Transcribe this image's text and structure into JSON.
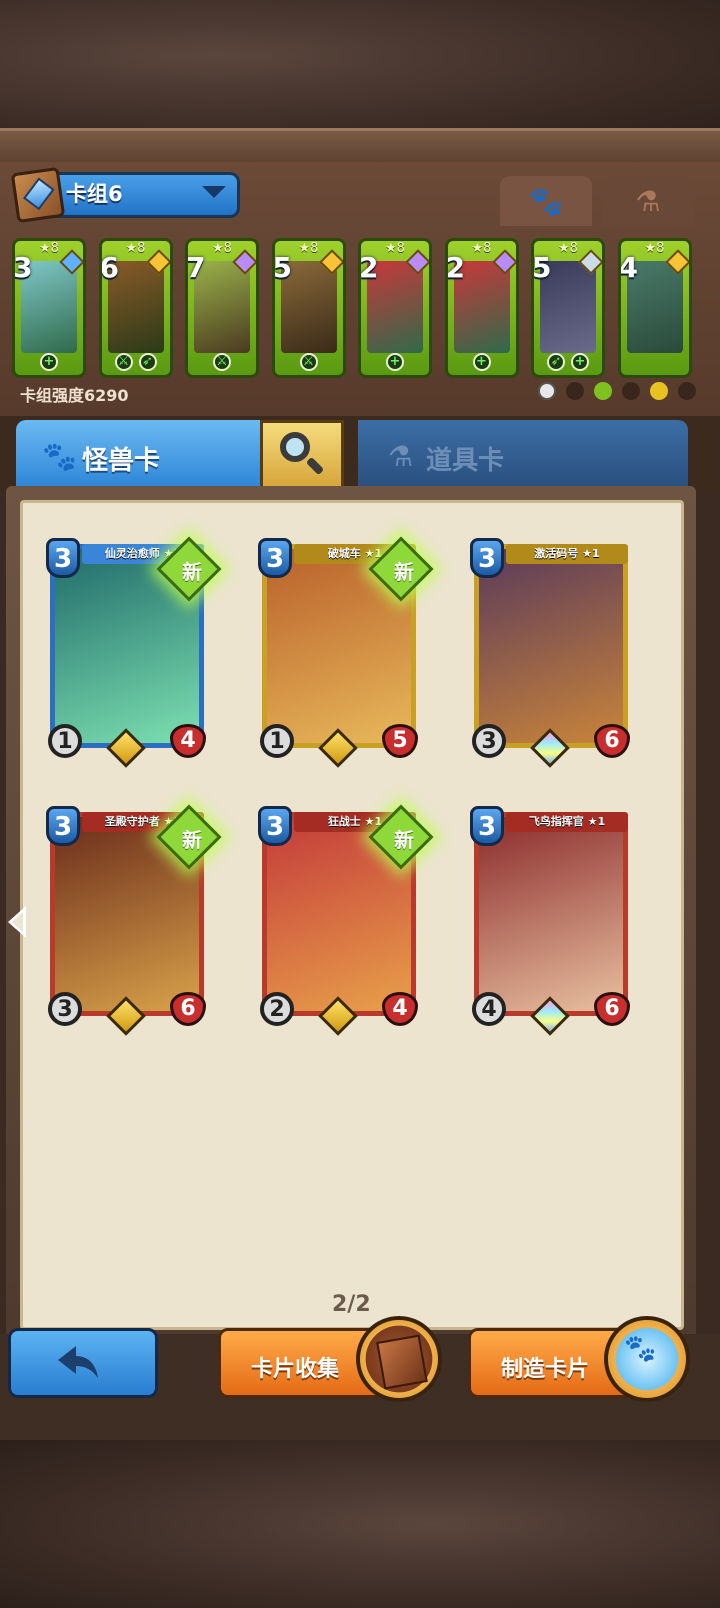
{
  "deck": {
    "name": "卡组6",
    "power_label": "卡组强度6290",
    "cards": [
      {
        "cost": "3",
        "stars": "★8",
        "gem": "#5fb0ff",
        "colors": [
          "#7fc7c8",
          "#2f6a4a"
        ],
        "foot": [
          "+"
        ]
      },
      {
        "cost": "6",
        "stars": "★8",
        "gem": "#f6c436",
        "colors": [
          "#8a5a28",
          "#2a3a18"
        ],
        "foot": [
          "⚔",
          "➶"
        ]
      },
      {
        "cost": "7",
        "stars": "★8",
        "gem": "#b98cf5",
        "colors": [
          "#9ab24a",
          "#4a3a20"
        ],
        "foot": [
          "⚔"
        ]
      },
      {
        "cost": "5",
        "stars": "★8",
        "gem": "#f6c436",
        "colors": [
          "#8a6a3a",
          "#3a2a18"
        ],
        "foot": [
          "⚔"
        ]
      },
      {
        "cost": "2",
        "stars": "★8",
        "gem": "#b98cf5",
        "colors": [
          "#c9383a",
          "#2f6a4a"
        ],
        "foot": [
          "+"
        ]
      },
      {
        "cost": "2",
        "stars": "★8",
        "gem": "#b98cf5",
        "colors": [
          "#c9383a",
          "#2f6a4a"
        ],
        "foot": [
          "+"
        ]
      },
      {
        "cost": "5",
        "stars": "★8",
        "gem": "#c9dbe8",
        "colors": [
          "#3a3a5a",
          "#6a6a8a"
        ],
        "foot": [
          "➶",
          "+"
        ]
      },
      {
        "cost": "4",
        "stars": "★8",
        "gem": "#f6c436",
        "colors": [
          "#4a7a6a",
          "#2a4a3a"
        ],
        "foot": []
      }
    ]
  },
  "tabs": {
    "monster": "怪兽卡",
    "item": "道具卡"
  },
  "cards": [
    {
      "name": "仙灵治愈师 ★1",
      "cost": "3",
      "atk": "1",
      "hp": "4",
      "new": "新",
      "frame": "#2a6fc0",
      "banner": "#3a85d8",
      "art": [
        "#1f6a6a",
        "#7de0b0"
      ],
      "rarity": "gold"
    },
    {
      "name": "破城车 ★1",
      "cost": "3",
      "atk": "1",
      "hp": "5",
      "new": "新",
      "frame": "#c8a024",
      "banner": "#b18a1a",
      "art": [
        "#b8602a",
        "#e8b85a"
      ],
      "rarity": "gold"
    },
    {
      "name": "激活码号 ★1",
      "cost": "3",
      "atk": "3",
      "hp": "6",
      "new": "",
      "frame": "#c8a024",
      "banner": "#b18a1a",
      "art": [
        "#5a3a5a",
        "#c9843a"
      ],
      "rarity": "rainbow"
    },
    {
      "name": "圣殿守护者 ★1",
      "cost": "3",
      "atk": "3",
      "hp": "6",
      "new": "新",
      "frame": "#b83a2a",
      "banner": "#a52c22",
      "art": [
        "#6a2a1a",
        "#d8a24a"
      ],
      "rarity": "gold"
    },
    {
      "name": "狂战士 ★1",
      "cost": "3",
      "atk": "2",
      "hp": "4",
      "new": "新",
      "frame": "#b83a2a",
      "banner": "#a52c22",
      "art": [
        "#c43a3a",
        "#e8a04a"
      ],
      "rarity": "gold"
    },
    {
      "name": "飞鸟指挥官 ★1",
      "cost": "3",
      "atk": "4",
      "hp": "6",
      "new": "",
      "frame": "#b83a2a",
      "banner": "#a52c22",
      "art": [
        "#8a2a2a",
        "#e8c0a0"
      ],
      "rarity": "rainbow"
    }
  ],
  "pager": "2/2",
  "buttons": {
    "collect": "卡片收集",
    "craft": "制造卡片"
  }
}
